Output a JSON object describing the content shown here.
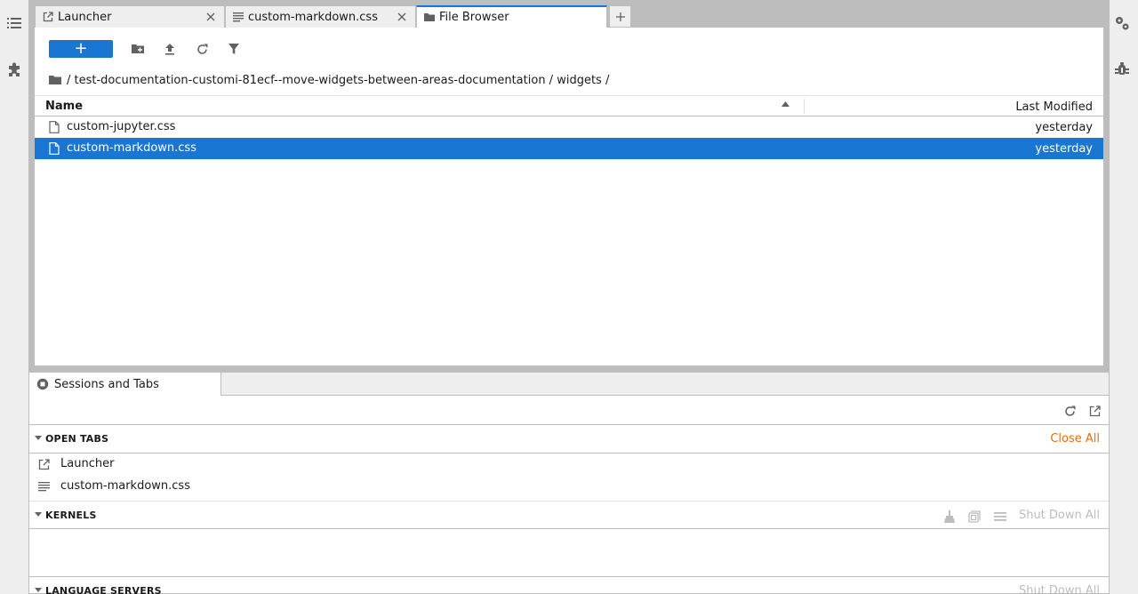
{
  "left_sidebar": {
    "icons": [
      "table-of-contents-icon",
      "extension-manager-icon"
    ]
  },
  "right_sidebar": {
    "icons": [
      "property-inspector-icon",
      "debugger-icon"
    ]
  },
  "main_tabs": [
    {
      "label": "Launcher",
      "icon": "launcher-icon"
    },
    {
      "label": "custom-markdown.css",
      "icon": "text-file-icon"
    },
    {
      "label": "File Browser",
      "icon": "folder-icon"
    }
  ],
  "file_browser": {
    "new_button_label": "+",
    "breadcrumb": "/ test-documentation-customi-81ecf--move-widgets-between-areas-documentation / widgets /",
    "columns": {
      "name": "Name",
      "modified": "Last Modified"
    },
    "files": [
      {
        "name": "custom-jupyter.css",
        "modified": "yesterday",
        "selected": false
      },
      {
        "name": "custom-markdown.css",
        "modified": "yesterday",
        "selected": true
      }
    ]
  },
  "bottom_panel": {
    "tab_label": "Sessions and Tabs",
    "open_tabs": {
      "title": "OPEN TABS",
      "action": "Close All",
      "items": [
        {
          "label": "Launcher",
          "icon": "launcher-icon"
        },
        {
          "label": "custom-markdown.css",
          "icon": "text-file-icon"
        }
      ]
    },
    "kernels": {
      "title": "KERNELS",
      "action": "Shut Down All"
    },
    "language_servers": {
      "title": "LANGUAGE SERVERS",
      "action": "Shut Down All"
    }
  },
  "colors": {
    "accent": "#1976d2",
    "action": "#ef6c00",
    "disabled": "#bdbdbd"
  }
}
